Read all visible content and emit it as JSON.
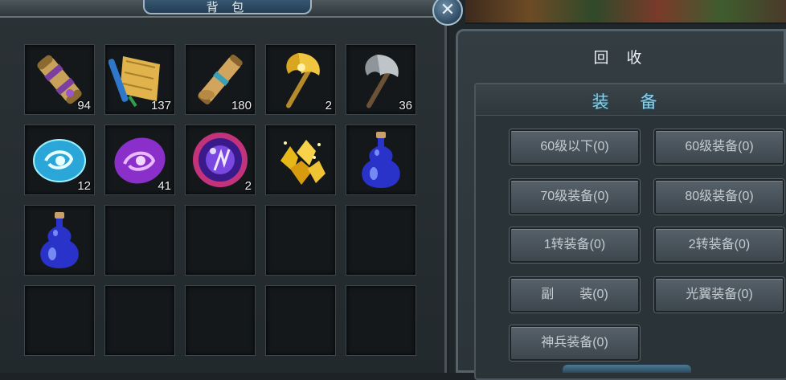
{
  "inventory": {
    "title": "背 包",
    "rows": [
      [
        {
          "icon": "scroll-bundle-purple-icon",
          "count": "94"
        },
        {
          "icon": "blue-gold-scroll-icon",
          "count": "137"
        },
        {
          "icon": "rolled-scroll-icon",
          "count": "180"
        },
        {
          "icon": "golden-axe-icon",
          "count": "2"
        },
        {
          "icon": "iron-axe-icon",
          "count": "36"
        }
      ],
      [
        {
          "icon": "blue-rune-stone-icon",
          "count": "12"
        },
        {
          "icon": "purple-rune-stone-icon",
          "count": "41"
        },
        {
          "icon": "purple-orb-icon",
          "count": "2"
        },
        {
          "icon": "gold-nuggets-icon",
          "count": ""
        },
        {
          "icon": "blue-potion-icon",
          "count": ""
        }
      ],
      [
        {
          "icon": "blue-potion-icon",
          "count": ""
        },
        {
          "icon": "",
          "count": ""
        },
        {
          "icon": "",
          "count": ""
        },
        {
          "icon": "",
          "count": ""
        },
        {
          "icon": "",
          "count": ""
        }
      ],
      [
        {
          "icon": "",
          "count": ""
        },
        {
          "icon": "",
          "count": ""
        },
        {
          "icon": "",
          "count": ""
        },
        {
          "icon": "",
          "count": ""
        },
        {
          "icon": "",
          "count": ""
        }
      ]
    ]
  },
  "close": {
    "icon": "close-icon",
    "glyph": "✕"
  },
  "recycle": {
    "title": "回 收",
    "section_title": "装 备",
    "buttons": [
      "60级以下(0)",
      "60级装备(0)",
      "70级装备(0)",
      "80级装备(0)",
      "1转装备(0)",
      "2转装备(0)",
      "副　　装(0)",
      "光翼装备(0)",
      "神兵装备(0)"
    ]
  }
}
